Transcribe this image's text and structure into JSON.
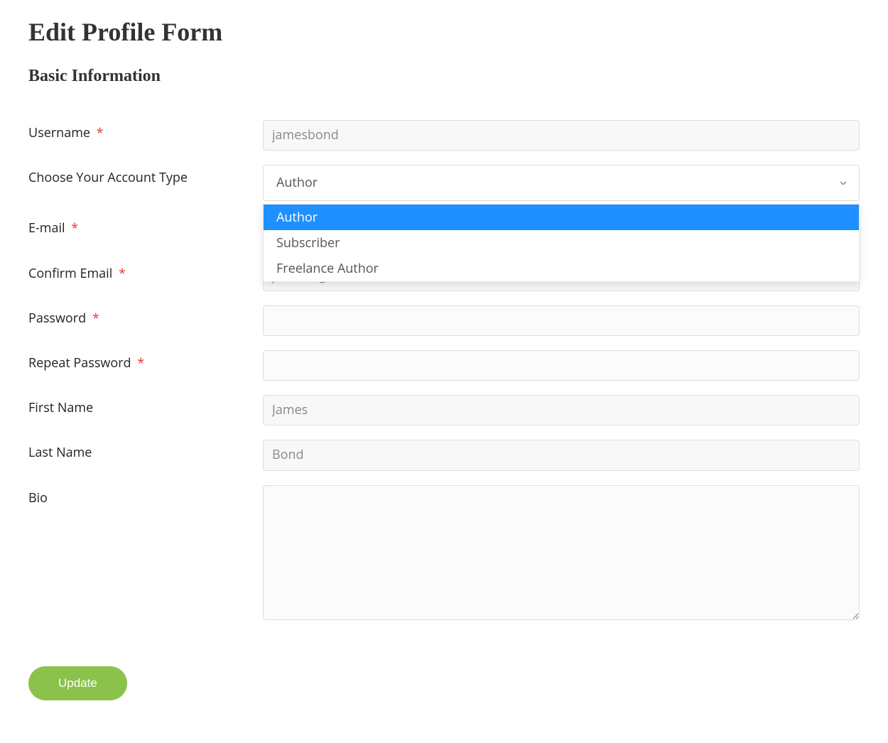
{
  "page": {
    "title": "Edit Profile Form",
    "section": "Basic Information"
  },
  "form": {
    "username": {
      "label": "Username",
      "required": true,
      "value": "jamesbond"
    },
    "account_type": {
      "label": "Choose Your Account Type",
      "required": false,
      "selected": "Author",
      "options": [
        "Author",
        "Subscriber",
        "Freelance Author"
      ]
    },
    "email": {
      "label": "E-mail",
      "required": true,
      "value": ""
    },
    "confirm_email": {
      "label": "Confirm Email",
      "required": true,
      "value": "james@gmail.com"
    },
    "password": {
      "label": "Password",
      "required": true,
      "value": ""
    },
    "repeat_password": {
      "label": "Repeat Password",
      "required": true,
      "value": ""
    },
    "first_name": {
      "label": "First Name",
      "required": false,
      "value": "James"
    },
    "last_name": {
      "label": "Last Name",
      "required": false,
      "value": "Bond"
    },
    "bio": {
      "label": "Bio",
      "required": false,
      "value": ""
    }
  },
  "buttons": {
    "update": "Update"
  },
  "required_marker": "*"
}
